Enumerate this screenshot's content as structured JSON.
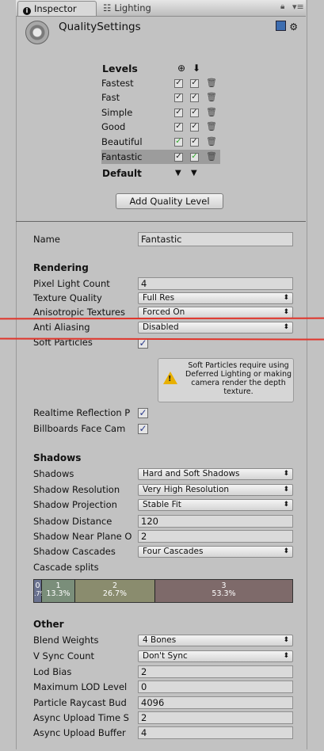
{
  "tabs": [
    {
      "label": "Inspector"
    },
    {
      "label": "Lighting"
    }
  ],
  "header": {
    "title": "QualitySettings"
  },
  "levels": {
    "heading": "Levels",
    "rows": [
      {
        "name": "Fastest"
      },
      {
        "name": "Fast"
      },
      {
        "name": "Simple"
      },
      {
        "name": "Good"
      },
      {
        "name": "Beautiful"
      },
      {
        "name": "Fantastic"
      }
    ],
    "default_label": "Default",
    "add_button": "Add Quality Level"
  },
  "name": {
    "label": "Name",
    "value": "Fantastic"
  },
  "rendering": {
    "heading": "Rendering",
    "pixel_light_count": {
      "label": "Pixel Light Count",
      "value": "4"
    },
    "texture_quality": {
      "label": "Texture Quality",
      "value": "Full Res"
    },
    "anisotropic": {
      "label": "Anisotropic Textures",
      "value": "Forced On"
    },
    "anti_aliasing": {
      "label": "Anti Aliasing",
      "value": "Disabled"
    },
    "soft_particles": {
      "label": "Soft Particles"
    },
    "help": "Soft Particles require using Deferred Lighting or making camera render the depth texture.",
    "realtime_reflection": {
      "label": "Realtime Reflection P"
    },
    "billboards": {
      "label": "Billboards Face Cam"
    }
  },
  "shadows": {
    "heading": "Shadows",
    "shadows": {
      "label": "Shadows",
      "value": "Hard and Soft Shadows"
    },
    "resolution": {
      "label": "Shadow Resolution",
      "value": "Very High Resolution"
    },
    "projection": {
      "label": "Shadow Projection",
      "value": "Stable Fit"
    },
    "distance": {
      "label": "Shadow Distance",
      "value": "120"
    },
    "near_plane": {
      "label": "Shadow Near Plane O",
      "value": "2"
    },
    "cascades": {
      "label": "Shadow Cascades",
      "value": "Four Cascades"
    },
    "cascade_splits": {
      "label": "Cascade splits"
    },
    "segments": [
      {
        "index": "0",
        "pct": ".7%",
        "color": "#6a7290"
      },
      {
        "index": "1",
        "pct": "13.3%",
        "color": "#7a8e7a"
      },
      {
        "index": "2",
        "pct": "26.7%",
        "color": "#8a8c6e"
      },
      {
        "index": "3",
        "pct": "53.3%",
        "color": "#7e6a6a"
      }
    ]
  },
  "other": {
    "heading": "Other",
    "blend_weights": {
      "label": "Blend Weights",
      "value": "4 Bones"
    },
    "vsync": {
      "label": "V Sync Count",
      "value": "Don't Sync"
    },
    "lod_bias": {
      "label": "Lod Bias",
      "value": "2"
    },
    "max_lod": {
      "label": "Maximum LOD Level",
      "value": "0"
    },
    "particle_raycast": {
      "label": "Particle Raycast Bud",
      "value": "4096"
    },
    "async_time": {
      "label": "Async Upload Time S",
      "value": "2"
    },
    "async_buffer": {
      "label": "Async Upload Buffer",
      "value": "4"
    }
  },
  "colors": {
    "highlight_line": "#e0342a"
  }
}
